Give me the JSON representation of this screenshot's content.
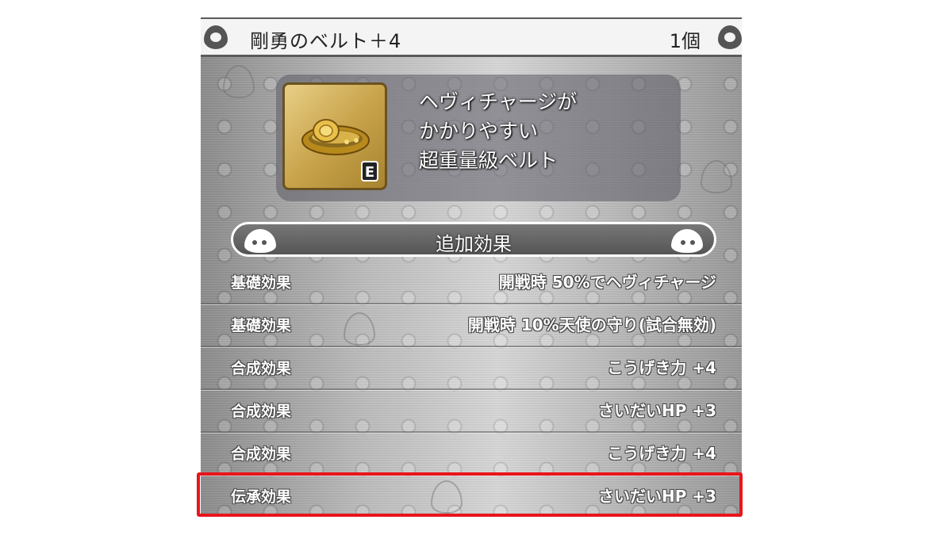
{
  "title_bar": {
    "item_name": "剛勇のベルト＋4",
    "quantity": "1個"
  },
  "item": {
    "icon": "gold-belt-icon",
    "equipped_badge": "E",
    "description": [
      "ヘヴィチャージが",
      "かかりやすい",
      "超重量級ベルト"
    ]
  },
  "effects": {
    "header": "追加効果",
    "rows": [
      {
        "label": "基礎効果",
        "value": "開戦時 50%でヘヴィチャージ"
      },
      {
        "label": "基礎効果",
        "value": "開戦時 10%天使の守り(試合無効)"
      },
      {
        "label": "合成効果",
        "value": "こうげき力 +4"
      },
      {
        "label": "合成効果",
        "value": "さいだいHP +3"
      },
      {
        "label": "合成効果",
        "value": "こうげき力 +4"
      },
      {
        "label": "伝承効果",
        "value": "さいだいHP +3"
      }
    ]
  },
  "colors": {
    "highlight": "#e8151b"
  }
}
